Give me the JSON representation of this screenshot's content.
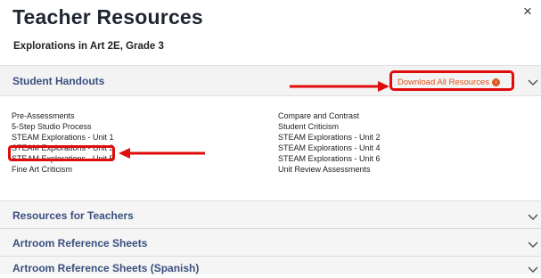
{
  "header": {
    "title": "Teacher Resources",
    "subtitle": "Explorations in Art 2E, Grade 3",
    "close_label": "×"
  },
  "handouts": {
    "label": "Student Handouts",
    "download_label": "Download All Resources",
    "left_items": [
      "Pre-Assessments",
      "5-Step Studio Process",
      "STEAM Explorations - Unit 1",
      "STEAM Explorations - Unit 3",
      "STEAM Explorations - Unit 5",
      "Fine Art Criticism"
    ],
    "right_items": [
      "Compare and Contrast",
      "Student Criticism",
      "STEAM Explorations - Unit 2",
      "STEAM Explorations - Unit 4",
      "STEAM Explorations - Unit 6",
      "Unit Review Assessments"
    ]
  },
  "sections": [
    "Resources for Teachers",
    "Artroom Reference Sheets",
    "Artroom Reference Sheets (Spanish)"
  ],
  "colors": {
    "accent_red": "#e00b0b",
    "section_label": "#3b4f7f",
    "download_orange": "#e0561f"
  },
  "icons": [
    "close-icon",
    "chevron-down-icon",
    "download-circle-icon",
    "arrow-right-annotation",
    "arrow-left-annotation"
  ]
}
